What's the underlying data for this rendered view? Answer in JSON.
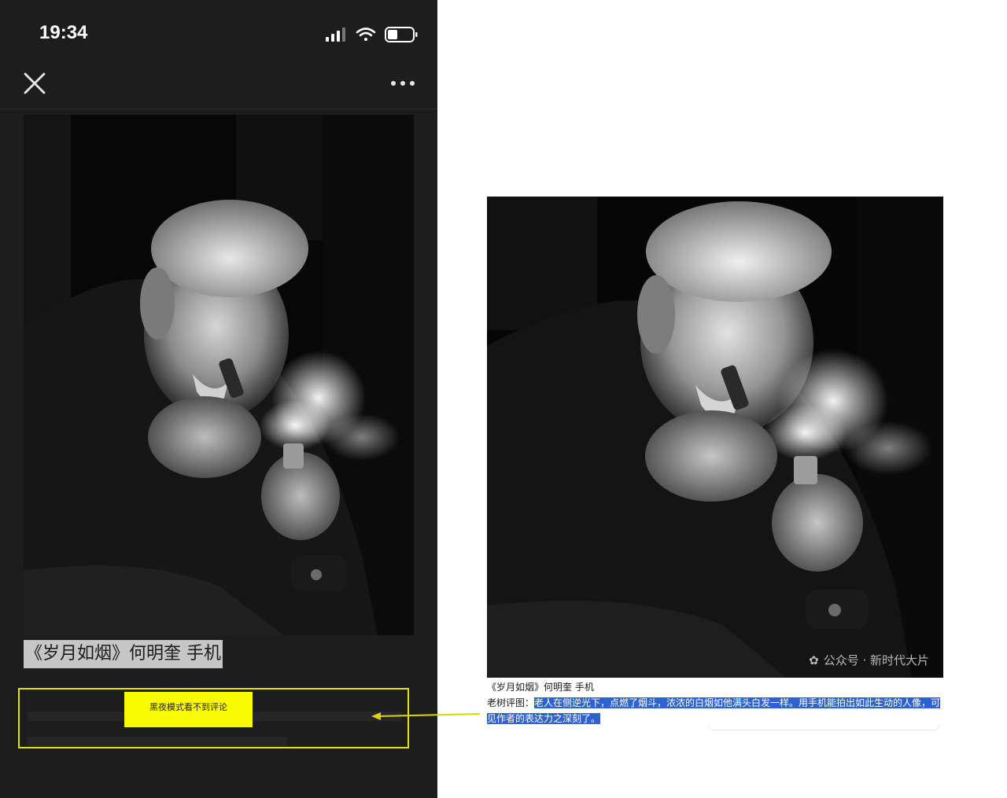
{
  "phone": {
    "status_bar": {
      "time": "19:34"
    },
    "caption": "《岁月如烟》何明奎 手机",
    "annotation": "黑夜模式看不到评论"
  },
  "article": {
    "watermark": "公众号 · 新时代大片",
    "caption": "《岁月如烟》何明奎 手机",
    "comment_label": "老树评图：",
    "comment_text": "老人在侧逆光下，点燃了烟斗，浓浓的白烟如他满头白发一样。用手机能拍出如此生动的人像，可见作者的表达力之深刻了。"
  },
  "colors": {
    "dark_bg": "#1d1d1d",
    "highlight_box": "#e6e200",
    "sticky_note": "#fbfb00",
    "selection": "#2d62cf"
  }
}
